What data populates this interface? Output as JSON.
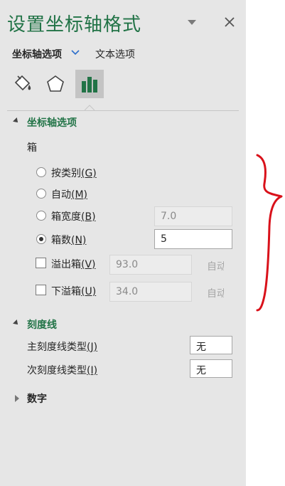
{
  "pane": {
    "title": "设置坐标轴格式",
    "tabs": [
      {
        "label": "坐标轴选项",
        "selected": true
      },
      {
        "label": "文本选项",
        "selected": false
      }
    ],
    "icons": [
      {
        "name": "fill-line-icon",
        "active": false
      },
      {
        "name": "effects-pentagon-icon",
        "active": false
      },
      {
        "name": "axis-options-bar-chart-icon",
        "active": true
      }
    ]
  },
  "axis_options": {
    "section_title": "坐标轴选项",
    "bins_label": "箱",
    "by_category": {
      "text": "按类别",
      "key": "(G)",
      "selected": false
    },
    "automatic": {
      "text": "自动",
      "key": "(M)",
      "selected": false
    },
    "bin_width": {
      "text": "箱宽度",
      "key": "(B)",
      "selected": false,
      "value": "7.0"
    },
    "bin_count": {
      "text": "箱数",
      "key": "(N)",
      "selected": true,
      "value": "5"
    },
    "overflow": {
      "text": "溢出箱",
      "key": "(V)",
      "checked": false,
      "value": "93.0",
      "auto_label": "自动"
    },
    "underflow": {
      "text": "下溢箱",
      "key": "(U)",
      "checked": false,
      "value": "34.0",
      "auto_label": "自动"
    }
  },
  "tick_marks": {
    "section_title": "刻度线",
    "major": {
      "label": "主刻度线类型",
      "key": "(J)",
      "value": "无"
    },
    "minor": {
      "label": "次刻度线类型",
      "key": "(I)",
      "value": "无"
    }
  },
  "number": {
    "section_title": "数字"
  },
  "colors": {
    "accent": "#217346",
    "pane_bg": "#e6e6e6",
    "annotation": "#d9111a"
  }
}
